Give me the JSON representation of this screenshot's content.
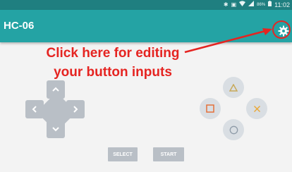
{
  "status_bar": {
    "icons": [
      "bluetooth-icon",
      "vibrate-icon",
      "wifi-icon",
      "signal-icon",
      "battery-icon"
    ],
    "battery": "86%",
    "time": "11:02"
  },
  "app_bar": {
    "title": "HC-06",
    "settings_icon": "gear-icon",
    "color": "#24a3a4"
  },
  "annotation": {
    "line1": "Click here for editing",
    "line2": "your button inputs",
    "color": "#e52421"
  },
  "dpad": {
    "up_icon": "chevron-up-icon",
    "down_icon": "chevron-down-icon",
    "left_icon": "chevron-left-icon",
    "right_icon": "chevron-right-icon",
    "color": "#b9bfc6"
  },
  "action_buttons": {
    "triangle": {
      "icon": "triangle-icon",
      "color": "#c8a95a"
    },
    "square": {
      "icon": "square-icon",
      "color": "#e4703a"
    },
    "cross": {
      "icon": "cross-icon",
      "color": "#e9a93a"
    },
    "circle": {
      "icon": "circle-icon",
      "color": "#8f9ba8"
    }
  },
  "bottom_buttons": {
    "select_label": "SELECT",
    "start_label": "START"
  }
}
